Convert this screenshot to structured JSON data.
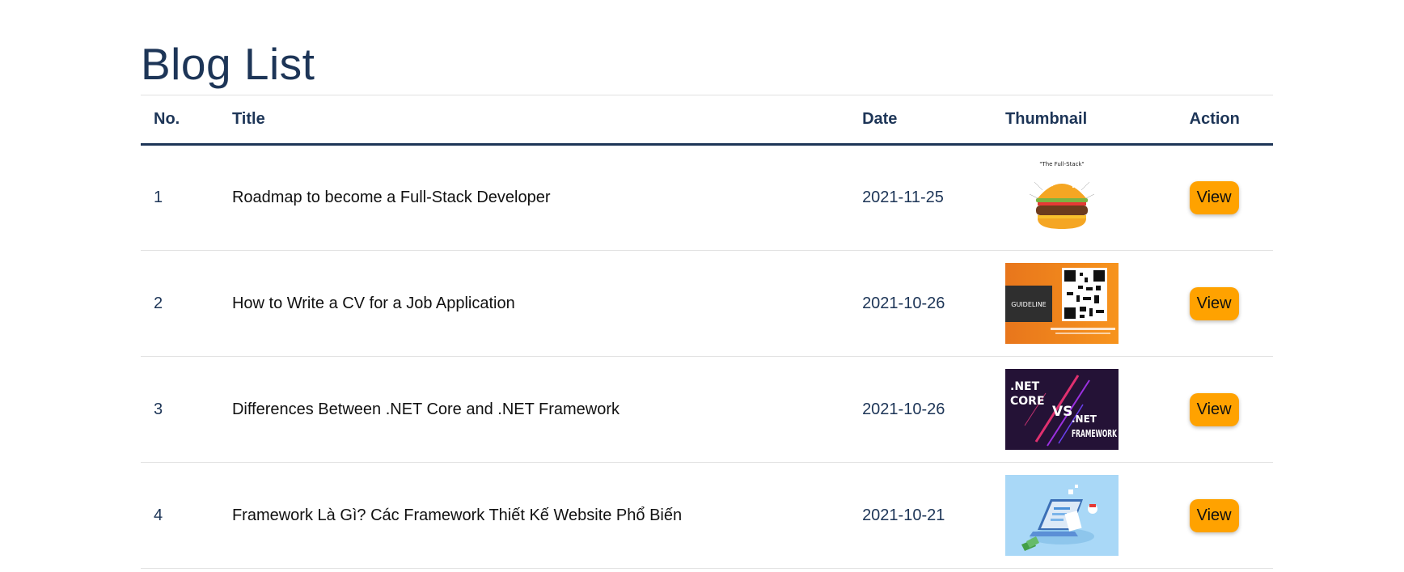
{
  "page": {
    "title": "Blog List"
  },
  "table": {
    "headers": {
      "no": "No.",
      "title": "Title",
      "date": "Date",
      "thumbnail": "Thumbnail",
      "action": "Action"
    },
    "rows": [
      {
        "no": "1",
        "title": "Roadmap to become a Full-Stack Developer",
        "date": "2021-11-25",
        "thumbnail_alt": "The Full-Stack",
        "action": "View"
      },
      {
        "no": "2",
        "title": "How to Write a CV for a Job Application",
        "date": "2021-10-26",
        "thumbnail_alt": "GUIDELINE",
        "action": "View"
      },
      {
        "no": "3",
        "title": "Differences Between .NET Core and .NET Framework",
        "date": "2021-10-26",
        "thumbnail_alt": ".NET CORE VS .NET FRAMEWORK",
        "action": "View"
      },
      {
        "no": "4",
        "title": "Framework Là Gì? Các Framework Thiết Kế Website Phổ Biến",
        "date": "2021-10-21",
        "thumbnail_alt": "",
        "action": "View"
      }
    ]
  },
  "thumbnails": {
    "row1": {
      "caption": "\"The Full-Stack\""
    },
    "row2": {
      "label": "GUIDELINE"
    },
    "row3": {
      "line1": ".NET",
      "line2": "CORE",
      "vs": "VS",
      "line3": ".NET",
      "line4": "FRAMEWORK"
    }
  },
  "colors": {
    "heading": "#1d3557",
    "button": "#ffa200",
    "divider": "#e2e2e2"
  }
}
